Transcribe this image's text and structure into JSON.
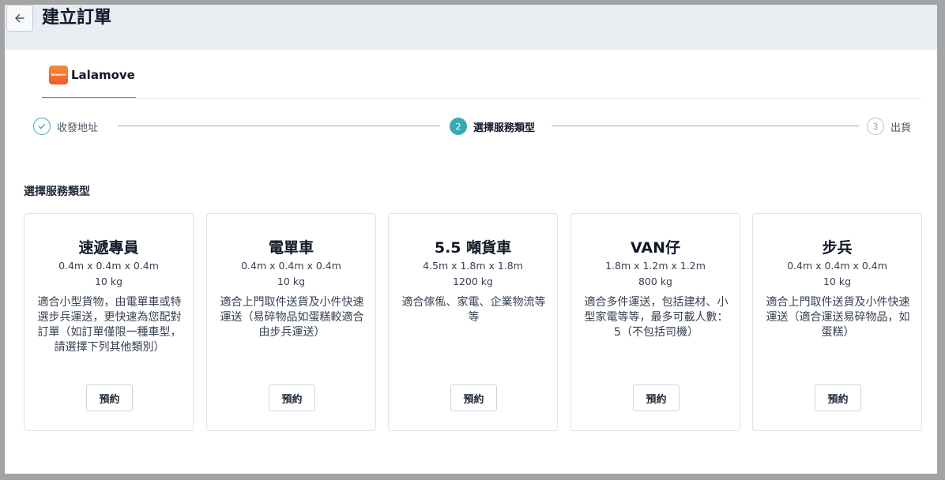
{
  "header": {
    "title": "建立訂單",
    "back_icon": "arrow-left-icon"
  },
  "provider_tab": {
    "label": "Lalamove",
    "logo_text": "lalamove",
    "logo_color": "#f26b2e"
  },
  "stepper": {
    "accent": "#37aab0",
    "steps": [
      {
        "index": "1",
        "label": "收發地址",
        "state": "done"
      },
      {
        "index": "2",
        "label": "選擇服務類型",
        "state": "active"
      },
      {
        "index": "3",
        "label": "出貨",
        "state": "todo"
      }
    ]
  },
  "section": {
    "title": "選擇服務類型"
  },
  "services": [
    {
      "name": "速遞專員",
      "dimensions": "0.4m x 0.4m x 0.4m",
      "weight": "10 kg",
      "description": "適合小型貨物，由電單車或特選步兵運送，更快速為您配對訂單（如訂單僅限一種車型，請選擇下列其他類別）",
      "button": "預約"
    },
    {
      "name": "電單車",
      "dimensions": "0.4m x 0.4m x 0.4m",
      "weight": "10 kg",
      "description": "適合上門取件送貨及小件快速運送（易碎物品如蛋糕較適合由步兵運送）",
      "button": "預約"
    },
    {
      "name": "5.5 噸貨車",
      "dimensions": "4.5m x 1.8m x 1.8m",
      "weight": "1200 kg",
      "description": "適合傢俬、家電、企業物流等等",
      "button": "預約"
    },
    {
      "name": "VAN仔",
      "dimensions": "1.8m x 1.2m x 1.2m",
      "weight": "800 kg",
      "description": "適合多件運送，包括建材、小型家電等等，最多可載人數：5（不包括司機）",
      "button": "預約"
    },
    {
      "name": "步兵",
      "dimensions": "0.4m x 0.4m x 0.4m",
      "weight": "10 kg",
      "description": "適合上門取件送貨及小件快速運送（適合運送易碎物品，如蛋糕）",
      "button": "預約"
    }
  ]
}
